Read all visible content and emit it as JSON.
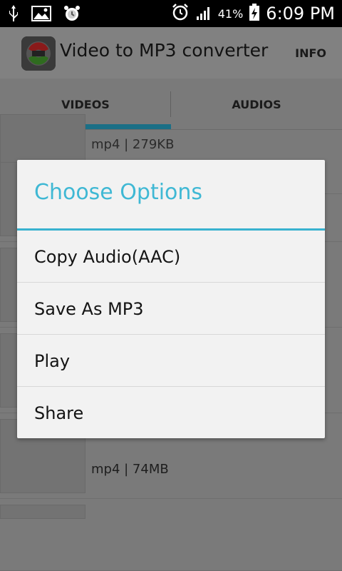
{
  "status_bar": {
    "battery_percent": "41%",
    "time": "6:09 PM"
  },
  "action_bar": {
    "title": "Video to MP3 converter",
    "info_label": "INFO"
  },
  "tabs": [
    {
      "label": "VIDEOS"
    },
    {
      "label": "AUDIOS"
    }
  ],
  "background_list": {
    "rows": [
      {
        "meta": "mp4 | 279KB"
      },
      {
        "meta": "mp4 | 74MB"
      }
    ]
  },
  "dialog": {
    "title": "Choose Options",
    "options": [
      {
        "label": "Copy Audio(AAC)"
      },
      {
        "label": "Save As MP3"
      },
      {
        "label": "Play"
      },
      {
        "label": "Share"
      }
    ]
  },
  "colors": {
    "accent": "#3fb8d4",
    "tab_indicator": "#1b6f86",
    "status_bar": "#000000",
    "dialog_bg": "#f2f2f2"
  }
}
